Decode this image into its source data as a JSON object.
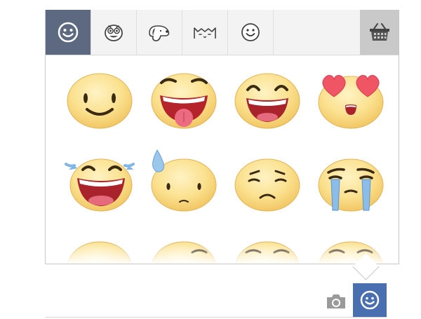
{
  "tabs": [
    {
      "name": "smiley",
      "icon": "smiley-icon",
      "active": true
    },
    {
      "name": "goofy-face",
      "icon": "goofy-face-icon",
      "active": false
    },
    {
      "name": "snoopy",
      "icon": "dog-icon",
      "active": false
    },
    {
      "name": "pusheen",
      "icon": "cat-icon",
      "active": false
    },
    {
      "name": "smiley-outline",
      "icon": "smiley-outline-icon",
      "active": false
    }
  ],
  "store": {
    "icon": "basket-icon"
  },
  "stickers": [
    "smile",
    "tongue-out",
    "laugh",
    "heart-eyes",
    "tears-of-joy",
    "nervous-sweat",
    "worried",
    "crying",
    "partial-1",
    "partial-2",
    "partial-3",
    "partial-4"
  ],
  "composer": {
    "camera_icon": "camera-icon",
    "emoji_icon": "smiley-icon"
  },
  "colors": {
    "accent": "#4a6fb1",
    "active_tab": "#5c6980",
    "sticker_face": "#f8d67a"
  }
}
